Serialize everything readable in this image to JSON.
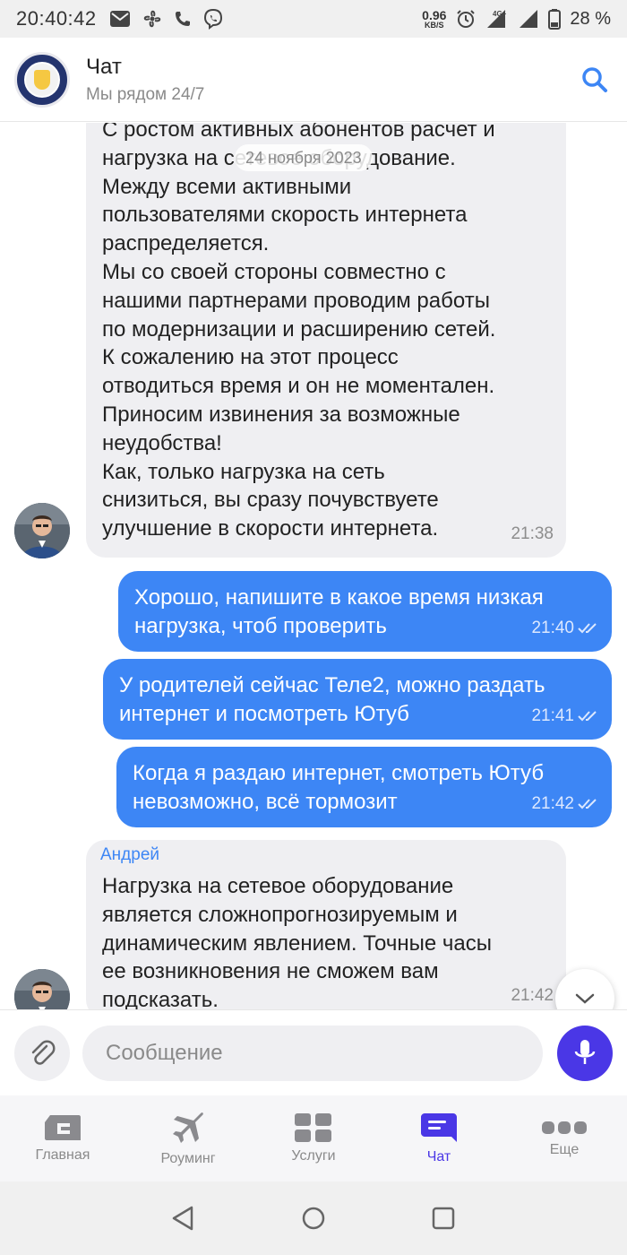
{
  "status_bar": {
    "time": "20:40:42",
    "speed_value": "0.96",
    "speed_unit": "KB/S",
    "network": "4G+",
    "battery": "28 %"
  },
  "header": {
    "title": "Чат",
    "subtitle": "Мы рядом 24/7"
  },
  "chat": {
    "date_chip": "24 ноября 2023",
    "messages": [
      {
        "direction": "incoming",
        "text": "С ростом активных абонентов расчет и\nнагрузка на сетевое оборудование.\nМежду всеми активными\nпользователями скорость интернета\nраспределяется.\nМы со своей стороны совместно с\nнашими партнерами проводим работы\nпо модернизации и расширению сетей.\nК сожалению на этот процесс\nотводиться время и он не моментален.\nПриносим извинения за возможные\nнеудобства!\nКак, только нагрузка на сеть\nснизиться, вы сразу почувствуете\nулучшение в скорости интернета.",
        "time": "21:38"
      },
      {
        "direction": "outgoing",
        "text": "Хорошо, напишите в какое время низкая\nнагрузка, чтоб проверить",
        "time": "21:40"
      },
      {
        "direction": "outgoing",
        "text": "У родителей сейчас Теле2, можно раздать\nинтернет и посмотреть Ютуб",
        "time": "21:41"
      },
      {
        "direction": "outgoing",
        "text": "Когда я раздаю интернет, смотреть Ютуб\nневозможно, всё тормозит",
        "time": "21:42"
      },
      {
        "direction": "incoming",
        "sender": "Андрей",
        "text": "Нагрузка на сетевое оборудование\nявляется сложнопрогнозируемым и\nдинамическим явлением. Точные часы\nее возникновения не сможем вам\nподсказать.",
        "time": "21:42"
      }
    ]
  },
  "composer": {
    "placeholder": "Сообщение"
  },
  "tabs": [
    {
      "label": "Главная",
      "icon": "home-card-icon",
      "active": false
    },
    {
      "label": "Роуминг",
      "icon": "airplane-icon",
      "active": false
    },
    {
      "label": "Услуги",
      "icon": "grid-icon",
      "active": false
    },
    {
      "label": "Чат",
      "icon": "chat-icon",
      "active": true
    },
    {
      "label": "Еще",
      "icon": "more-icon",
      "active": false
    }
  ],
  "colors": {
    "outgoing_bubble": "#3d86f5",
    "incoming_bubble": "#efeff2",
    "accent": "#4a37e6",
    "search_icon": "#3d86f5"
  }
}
